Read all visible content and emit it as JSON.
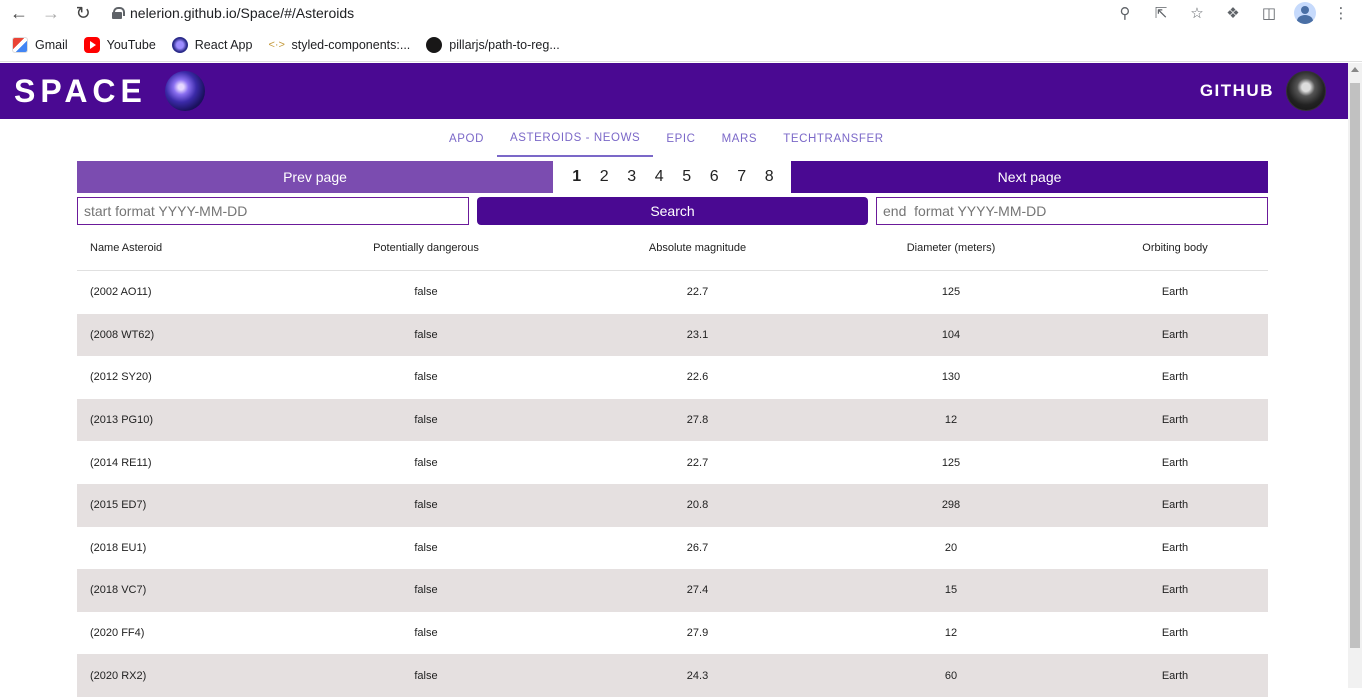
{
  "browser": {
    "url": "nelerion.github.io/Space/#/Asteroids",
    "bookmarks": [
      {
        "label": "Gmail",
        "icon": "gmail-icon"
      },
      {
        "label": "YouTube",
        "icon": "youtube-icon"
      },
      {
        "label": "React App",
        "icon": "react-icon"
      },
      {
        "label": "styled-components:...",
        "icon": "styled-components-icon"
      },
      {
        "label": "pillarjs/path-to-reg...",
        "icon": "github-icon"
      }
    ]
  },
  "header": {
    "logo_text": "SPACE",
    "github_label": "GITHUB",
    "background": "#4a0992"
  },
  "tabs": [
    {
      "label": "APOD",
      "active": false
    },
    {
      "label": "ASTEROIDS - NEOWS",
      "active": true
    },
    {
      "label": "EPIC",
      "active": false
    },
    {
      "label": "MARS",
      "active": false
    },
    {
      "label": "TECHTRANSFER",
      "active": false
    }
  ],
  "pager": {
    "prev_label": "Prev page",
    "next_label": "Next page",
    "pages": [
      "1",
      "2",
      "3",
      "4",
      "5",
      "6",
      "7",
      "8"
    ],
    "current_page": "1"
  },
  "search": {
    "start_placeholder": "start format YYYY-MM-DD",
    "end_placeholder": "end  format YYYY-MM-DD",
    "button_label": "Search"
  },
  "table": {
    "columns": [
      "Name Asteroid",
      "Potentially dangerous",
      "Absolute magnitude",
      "Diameter (meters)",
      "Orbiting body"
    ],
    "rows": [
      [
        "(2002 AO11)",
        "false",
        "22.7",
        "125",
        "Earth"
      ],
      [
        "(2008 WT62)",
        "false",
        "23.1",
        "104",
        "Earth"
      ],
      [
        "(2012 SY20)",
        "false",
        "22.6",
        "130",
        "Earth"
      ],
      [
        "(2013 PG10)",
        "false",
        "27.8",
        "12",
        "Earth"
      ],
      [
        "(2014 RE11)",
        "false",
        "22.7",
        "125",
        "Earth"
      ],
      [
        "(2015 ED7)",
        "false",
        "20.8",
        "298",
        "Earth"
      ],
      [
        "(2018 EU1)",
        "false",
        "26.7",
        "20",
        "Earth"
      ],
      [
        "(2018 VC7)",
        "false",
        "27.4",
        "15",
        "Earth"
      ],
      [
        "(2020 FF4)",
        "false",
        "27.9",
        "12",
        "Earth"
      ],
      [
        "(2020 RX2)",
        "false",
        "24.3",
        "60",
        "Earth"
      ]
    ]
  }
}
